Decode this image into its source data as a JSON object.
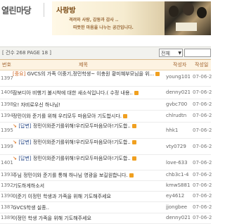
{
  "header": {
    "site_title": "열린마당",
    "board_title": "사랑방",
    "tagline_1": "격려와 사랑, 감동과 감사 ..",
    "tagline_2": "따뜻한 마음을 나누는 공간입니다."
  },
  "toolbar": {
    "count_text": "[ 건수 268    PAGE 18 ]",
    "filter_value": "전체"
  },
  "columns": {
    "no": "번호",
    "title": "제목",
    "author": "작성자",
    "date": "작성일"
  },
  "posts": [
    {
      "no": "1397",
      "prefix": "[중요]",
      "title": "GVCS의 가족 이중기,정민학생~ 이충원 황미혜부모님을 위...",
      "author": "young101",
      "date": "07-06-2"
    },
    {
      "no": "1406",
      "title": "잠보디아 비행기 불시착에 대한 새소식입니다.( 수정 내용..",
      "author": "denny021",
      "date": "07-06-2"
    },
    {
      "no": "1398",
      "title": "오! 자비로우신 하나님!",
      "author": "gvbc700",
      "date": "07-06-2"
    },
    {
      "no": "1394",
      "title": "정민이와 준기를 위해 우리모두 마음모아 기도합시다.",
      "author": "chlrudtn",
      "date": "07-06-2"
    },
    {
      "no": "1395",
      "reply": "[답변]",
      "title": "정민이와준기를위해!우리모두마음모아!기도합..",
      "author": "hhk1",
      "date": "07-06-2"
    },
    {
      "no": "1399",
      "reply": "[답변]",
      "title": "정민이와준기를위해!우리모두마음모아!기도합..",
      "author": "vty0729",
      "date": "07-06-2"
    },
    {
      "no": "1401",
      "reply": "[답변]",
      "title": "정민이와준기를위해!우리모두마음모아!기도합..",
      "author": "love-633",
      "date": "07-06-2"
    },
    {
      "no": "1393",
      "title": "주님 정민이와 준기를 통해 하나님 영광을 보길원합니다.",
      "author": "chb3c1-4",
      "date": "07-06-2"
    },
    {
      "no": "1392",
      "title": "기도하게하소서",
      "author": "kmwS881",
      "date": "07-06-2"
    },
    {
      "no": "1390",
      "title": "이준기 이정민 학생과 가족을 위해 기도해주세요",
      "author": "ey4612",
      "date": "07-06-2"
    },
    {
      "no": "1387",
      "title": "GVCS학생 실종..",
      "author": "jjongbee",
      "date": "07-06-2"
    },
    {
      "no": "1389",
      "title": "이정민 학생 가족을 위해 기도해주세요",
      "author": "denny021",
      "date": "07-06-2"
    }
  ]
}
